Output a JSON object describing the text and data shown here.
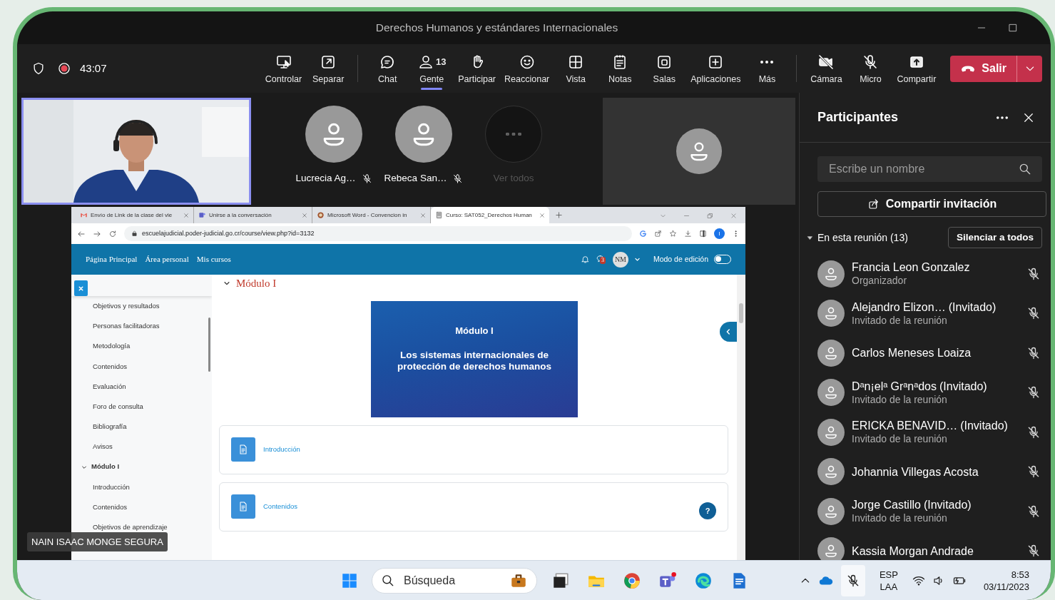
{
  "window": {
    "title": "Derechos Humanos y estándares Internacionales"
  },
  "meeting": {
    "recording": true,
    "timer": "43:07"
  },
  "toolbar": [
    {
      "items": [
        {
          "label": "Controlar",
          "selected": false
        },
        {
          "label": "Separar",
          "selected": false
        }
      ]
    },
    {
      "items": [
        {
          "label": "Chat",
          "selected": false
        },
        {
          "label": "Gente",
          "count": "13",
          "selected": true
        },
        {
          "label": "Participar",
          "selected": false
        },
        {
          "label": "Reaccionar",
          "selected": false
        },
        {
          "label": "Vista",
          "selected": false
        },
        {
          "label": "Notas",
          "selected": false
        },
        {
          "label": "Salas",
          "selected": false
        },
        {
          "label": "Aplicaciones",
          "selected": false
        },
        {
          "label": "Más",
          "selected": false
        }
      ]
    },
    {
      "items": [
        {
          "label": "Cámara",
          "selected": false
        },
        {
          "label": "Micro",
          "selected": false
        },
        {
          "label": "Compartir",
          "selected": false
        }
      ]
    }
  ],
  "leave": {
    "label": "Salir"
  },
  "stage": {
    "presenter": {
      "name": "NAIN ISAAC MONGE SEGURA",
      "kind": "picture"
    },
    "tiles": [
      {
        "name": "Lucrecia Ag…",
        "muted": true
      },
      {
        "name": "Rebeca San…",
        "muted": true
      }
    ],
    "more": {
      "label": "Ver todos"
    }
  },
  "browser": {
    "tabs": [
      {
        "title": "Envío de Link de la clase del vie",
        "selected": false
      },
      {
        "title": "Unirse a la conversación",
        "selected": false
      },
      {
        "title": "Microsoft Word - Convencion in",
        "selected": false
      },
      {
        "title": "Curso: SAT052_Derechos Human",
        "selected": true
      }
    ],
    "url": "escuelajudicial.poder-judicial.go.cr/course/view.php?id=3132",
    "profile": "I",
    "site": {
      "nav": [
        "Página Principal",
        "Área personal",
        "Mis cursos"
      ],
      "messages_count": "3",
      "user_initials": "NM",
      "edit_mode": {
        "label": "Modo de edición",
        "on": false
      },
      "index": [
        {
          "label": "Objetivos y resultados"
        },
        {
          "label": "Personas facilitadoras"
        },
        {
          "label": "Metodología"
        },
        {
          "label": "Contenidos"
        },
        {
          "label": "Evaluación"
        },
        {
          "label": "Foro de consulta"
        },
        {
          "label": "Bibliografía"
        },
        {
          "label": "Avisos"
        },
        {
          "label": "Módulo I",
          "expanded": true,
          "children": [
            {
              "label": "Introducción"
            },
            {
              "label": "Contenidos"
            },
            {
              "label": "Objetivos de aprendizaje"
            }
          ]
        }
      ],
      "section_title": "Módulo I",
      "banner": {
        "title": "Módulo I",
        "subtitle": "Los sistemas internacionales de protección de derechos humanos"
      },
      "activities": [
        {
          "label": "Introducción"
        },
        {
          "label": "Contenidos"
        }
      ],
      "help": "?"
    }
  },
  "participants": {
    "title": "Participantes",
    "search": {
      "placeholder": "Escribe un nombre"
    },
    "invite": "Compartir invitación",
    "section": {
      "label": "En esta reunión (13)",
      "expanded": true
    },
    "mute_all": "Silenciar a todos",
    "people": [
      {
        "name": "Francia Leon Gonzalez",
        "role": "Organizador",
        "muted": true
      },
      {
        "name": "Alejandro Elizon…",
        "tag": "(Invitado)",
        "role": "Invitado de la reunión",
        "muted": true
      },
      {
        "name": "Carlos Meneses Loaiza",
        "muted": true
      },
      {
        "name": "Dᵃn¡elᵃ Grᵃnᵃdos",
        "tag": "(Invitado)",
        "role": "Invitado de la reunión",
        "muted": true
      },
      {
        "name": "ERICKA BENAVID…",
        "tag": "(Invitado)",
        "role": "Invitado de la reunión",
        "muted": true
      },
      {
        "name": "Johannia Villegas Acosta",
        "muted": true
      },
      {
        "name": "Jorge Castillo",
        "tag": "(Invitado)",
        "role": "Invitado de la reunión",
        "muted": true
      },
      {
        "name": "Kassia Morgan Andrade",
        "muted": true
      }
    ]
  },
  "taskbar": {
    "search": {
      "placeholder": "Búsqueda"
    },
    "language": "ESP",
    "layout": "LAA",
    "time": "8:53",
    "date": "03/11/2023"
  }
}
